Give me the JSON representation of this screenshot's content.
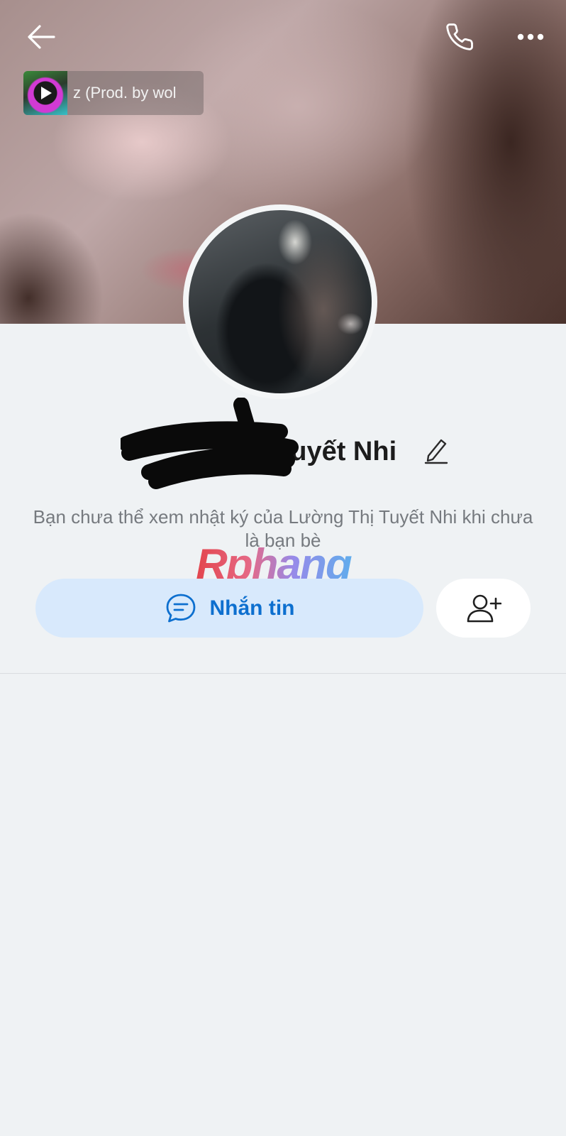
{
  "header": {
    "back_icon": "arrow-left-icon",
    "call_icon": "phone-icon",
    "more_icon": "more-horizontal-icon"
  },
  "music": {
    "title": "z (Prod. by wol",
    "play_icon": "play-icon"
  },
  "profile": {
    "name_visible": "Tuyết Nhi",
    "edit_icon": "pencil-icon"
  },
  "notice": {
    "text": "Bạn chưa thể xem nhật ký của Lường Thị Tuyết Nhi khi chưa là bạn bè"
  },
  "watermark": {
    "text": "Rphang"
  },
  "actions": {
    "message_label": "Nhắn tin",
    "message_icon": "chat-bubble-icon",
    "add_friend_icon": "user-plus-icon"
  },
  "colors": {
    "accent": "#0d6fcf",
    "message_button_bg": "#d8e9fc",
    "page_bg": "#eff2f4"
  }
}
